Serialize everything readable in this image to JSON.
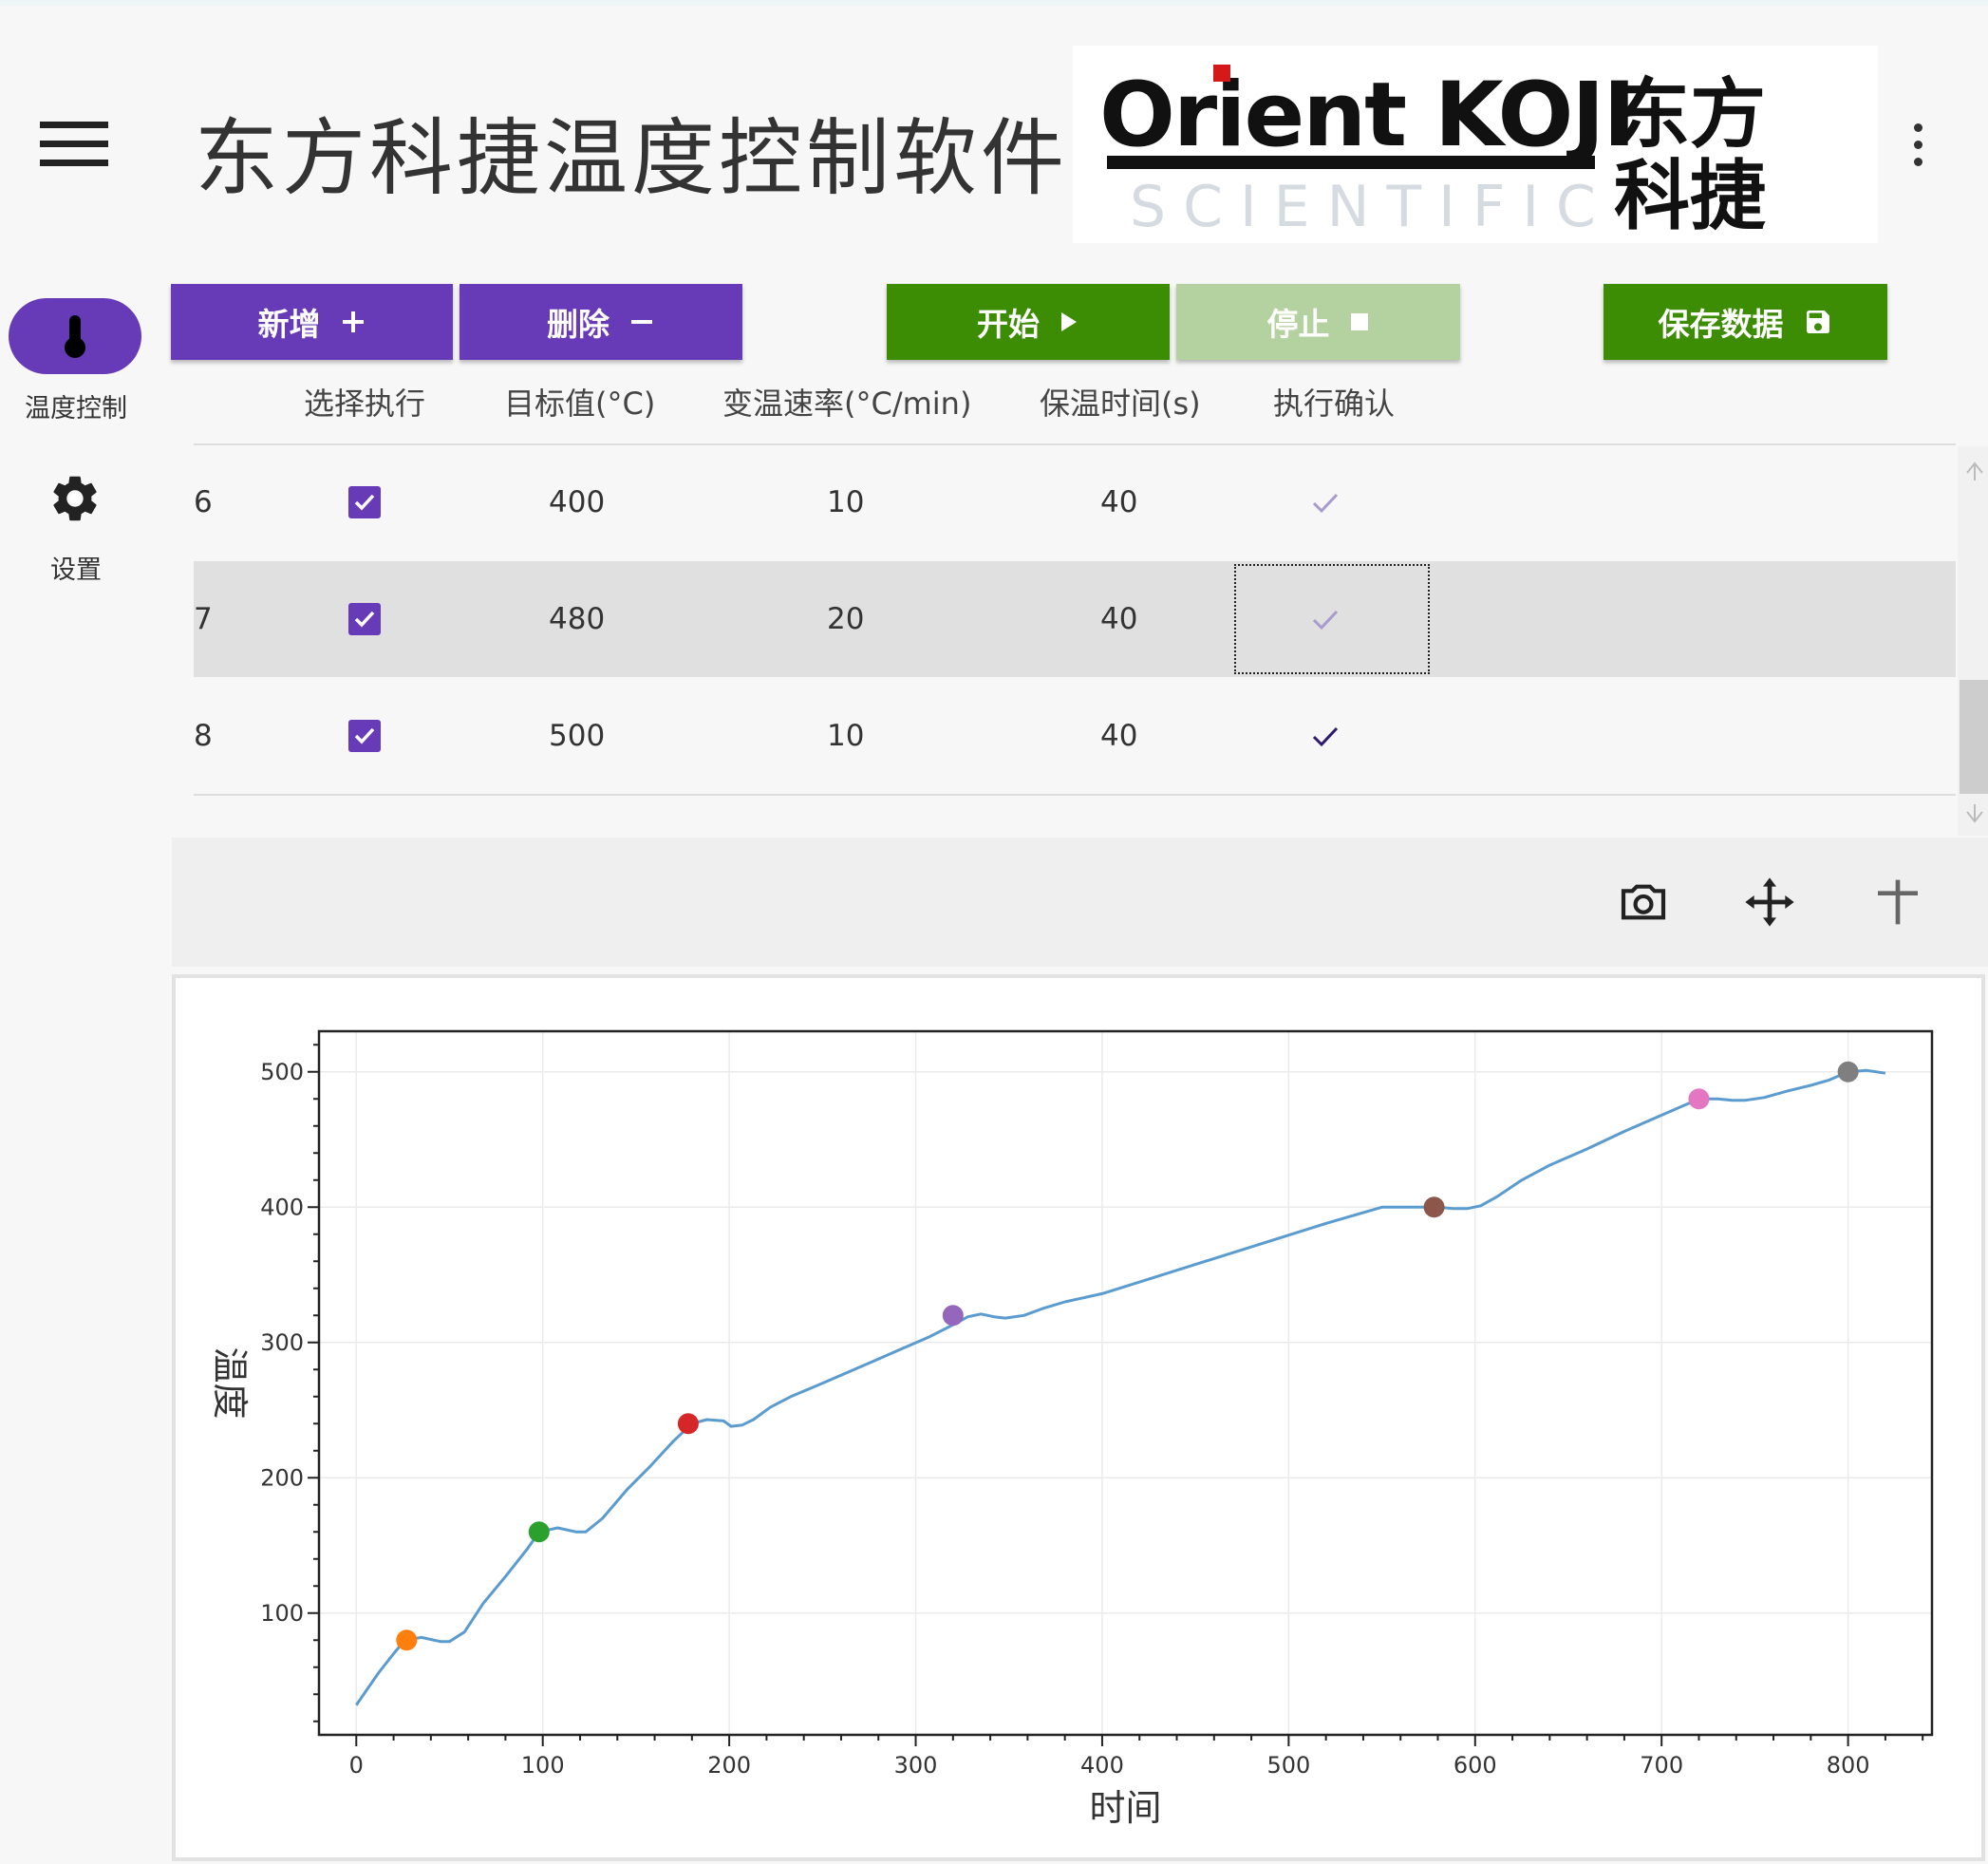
{
  "app": {
    "title": "东方科捷温度控制软件",
    "logo": {
      "brand_en": "Orient KOJI",
      "brand_sub": "SCIENTIFIC",
      "brand_cn_line1": "东方",
      "brand_cn_line2": "科捷"
    }
  },
  "sidebar": {
    "items": [
      {
        "label": "温度控制",
        "icon": "thermometer-icon",
        "active": true
      },
      {
        "label": "设置",
        "icon": "gear-icon",
        "active": false
      }
    ]
  },
  "toolbar": {
    "add_label": "新增",
    "delete_label": "删除",
    "start_label": "开始",
    "stop_label": "停止",
    "save_label": "保存数据"
  },
  "table": {
    "headers": [
      "选择执行",
      "目标值(°C)",
      "变温速率(°C/min)",
      "保温时间(s)",
      "执行确认"
    ],
    "rows": [
      {
        "index": "6",
        "selected": true,
        "target": "400",
        "rate": "10",
        "hold": "40",
        "confirmed": "faded"
      },
      {
        "index": "7",
        "selected": true,
        "target": "480",
        "rate": "20",
        "hold": "40",
        "confirmed": "faded"
      },
      {
        "index": "8",
        "selected": true,
        "target": "500",
        "rate": "10",
        "hold": "40",
        "confirmed": "dark"
      }
    ]
  },
  "colors": {
    "accent": "#673ab7",
    "green": "#3c8c04",
    "green_disabled": "#b4d2a0",
    "line": "#5a9bd0"
  },
  "chart_tools": [
    "camera-icon",
    "pan-icon",
    "zoom-crosshair-icon"
  ],
  "chart_data": {
    "type": "line",
    "xlabel": "时间",
    "ylabel": "温度",
    "xlim": [
      -20,
      845
    ],
    "ylim": [
      10,
      530
    ],
    "xticks": [
      "0",
      "100",
      "200",
      "300",
      "400",
      "500",
      "600",
      "700",
      "800"
    ],
    "yticks": [
      "100",
      "200",
      "300",
      "400",
      "500"
    ],
    "grid": true,
    "series": [
      {
        "x": [
          0,
          5,
          12,
          20,
          26,
          35,
          45,
          50,
          58,
          68,
          80,
          92,
          98,
          108,
          118,
          123,
          132,
          145,
          158,
          170,
          180,
          188,
          197,
          201,
          207,
          213,
          222,
          233,
          247,
          262,
          277,
          292,
          307,
          320,
          328,
          335,
          342,
          348,
          358,
          368,
          380,
          400,
          430,
          460,
          490,
          520,
          550,
          580,
          588,
          596,
          603,
          612,
          625,
          640,
          660,
          680,
          700,
          720,
          730,
          738,
          745,
          755,
          768,
          780,
          790,
          800,
          810,
          820
        ],
        "y": [
          32,
          42,
          56,
          70,
          80,
          82,
          79,
          79,
          86,
          107,
          127,
          148,
          160,
          163,
          160,
          160,
          170,
          191,
          209,
          227,
          240,
          243,
          242,
          238,
          239,
          243,
          252,
          260,
          268,
          277,
          286,
          295,
          304,
          313,
          319,
          321,
          319,
          318,
          320,
          325,
          330,
          336,
          349,
          362,
          375,
          388,
          400,
          400,
          399,
          399,
          401,
          408,
          420,
          431,
          443,
          456,
          468,
          480,
          480,
          479,
          479,
          481,
          486,
          490,
          494,
          500,
          501,
          499
        ]
      }
    ],
    "markers": [
      {
        "x": 27,
        "y": 80,
        "color": "#ff7f0e"
      },
      {
        "x": 98,
        "y": 160,
        "color": "#2ca02c"
      },
      {
        "x": 178,
        "y": 240,
        "color": "#d62728"
      },
      {
        "x": 320,
        "y": 320,
        "color": "#9467bd"
      },
      {
        "x": 578,
        "y": 400,
        "color": "#8c564b"
      },
      {
        "x": 720,
        "y": 480,
        "color": "#e377c2"
      },
      {
        "x": 800,
        "y": 500,
        "color": "#7f7f7f"
      }
    ]
  }
}
